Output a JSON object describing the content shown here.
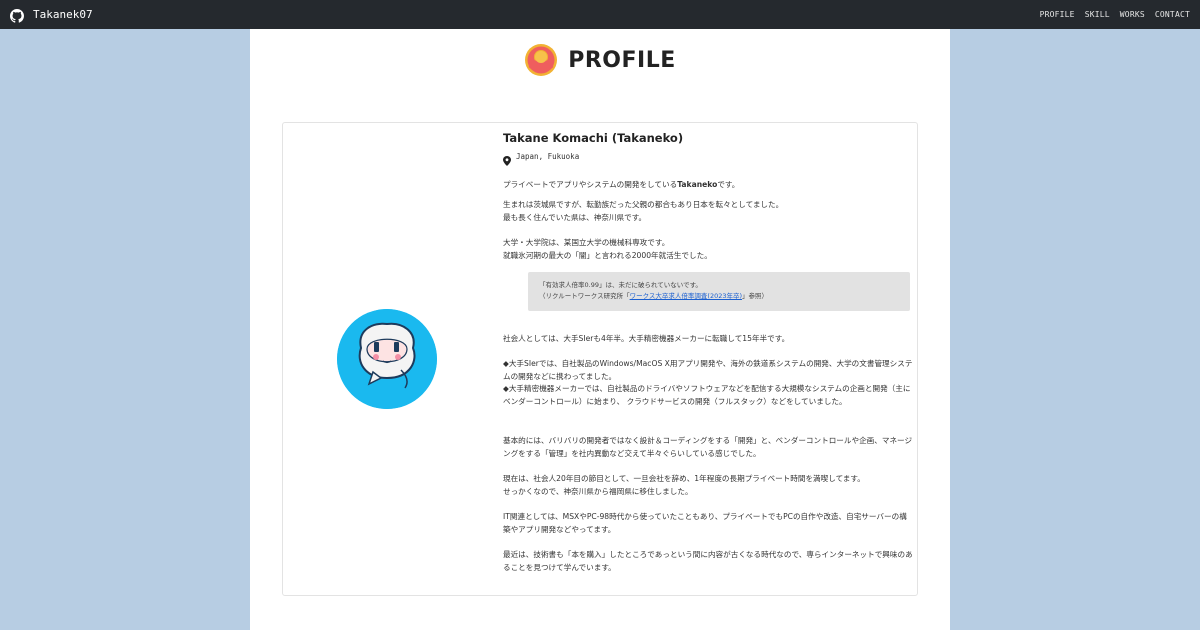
{
  "nav": {
    "brand": "Takanek07",
    "links": [
      "PROFILE",
      "SKILL",
      "WORKS",
      "CONTACT"
    ]
  },
  "header": {
    "title": "PROFILE"
  },
  "profile": {
    "name": "Takane Komachi (Takaneko)",
    "location": "Japan, Fukuoka",
    "intro_prefix": "プライベートでアプリやシステムの開発をしている",
    "intro_bold": "Takaneko",
    "intro_suffix": "です。",
    "birth": "生まれは茨城県ですが、転勤族だった父親の都合もあり日本を転々としてました。\n最も長く住んでいた県は、神奈川県です。",
    "university": "大学・大学院は、某国立大学の機械科専攻です。\n就職氷河期の最大の「闇」と言われる2000年就活生でした。",
    "quote_line1": "「有効求人倍率0.99」は、未だに破られていないです。",
    "quote_prefix": "（リクルートワークス研究所「",
    "quote_link": "ワークス大卒求人倍率調査(2023年卒)",
    "quote_suffix": "」参照）",
    "career": "社会人としては、大手SIerも4年半。大手精密機器メーカーに転職して15年半です。",
    "sier": "◆大手SIerでは、自社製品のWindows/MacOS X用アプリ開発や、海外の鉄道系システムの開発、大学の文書管理システムの開発などに携わってました。\n◆大手精密機器メーカーでは、自社製品のドライバやソフトウェアなどを配信する大規模なシステムの企画と開発（主にベンダーコントロール）に始まり、 クラウドサービスの開発（フルスタック）などをしていました。",
    "basic": "基本的には、バリバリの開発者ではなく設計＆コーディングをする「開発」と、ベンダーコントロールや企画、マネージングをする「管理」を社内異動など交えて半々ぐらいしている感じでした。",
    "now": "現在は、社会人20年目の節目として、一旦会社を辞め、1年程度の長期プライベート時間を満喫してます。\nせっかくなので、神奈川県から福岡県に移住しました。",
    "it": "IT関連としては、MSXやPC-98時代から使っていたこともあり、プライベートでもPCの自作や改造、自宅サーバーの構築やアプリ開発などやってます。",
    "recent": "最近は、技術書も「本を購入」したところであっという間に内容が古くなる時代なので、専らインターネットで興味のあることを見つけて学んでいます。"
  },
  "colors": {
    "navbar": "#25292e",
    "background": "#b7cde3",
    "avatar_bg": "#1ab9ef",
    "link": "#1a5fd0",
    "quote_bg": "#e2e2e2"
  },
  "icons": [
    "github-icon",
    "profile-icon",
    "location-pin-icon",
    "avatar-icon"
  ]
}
